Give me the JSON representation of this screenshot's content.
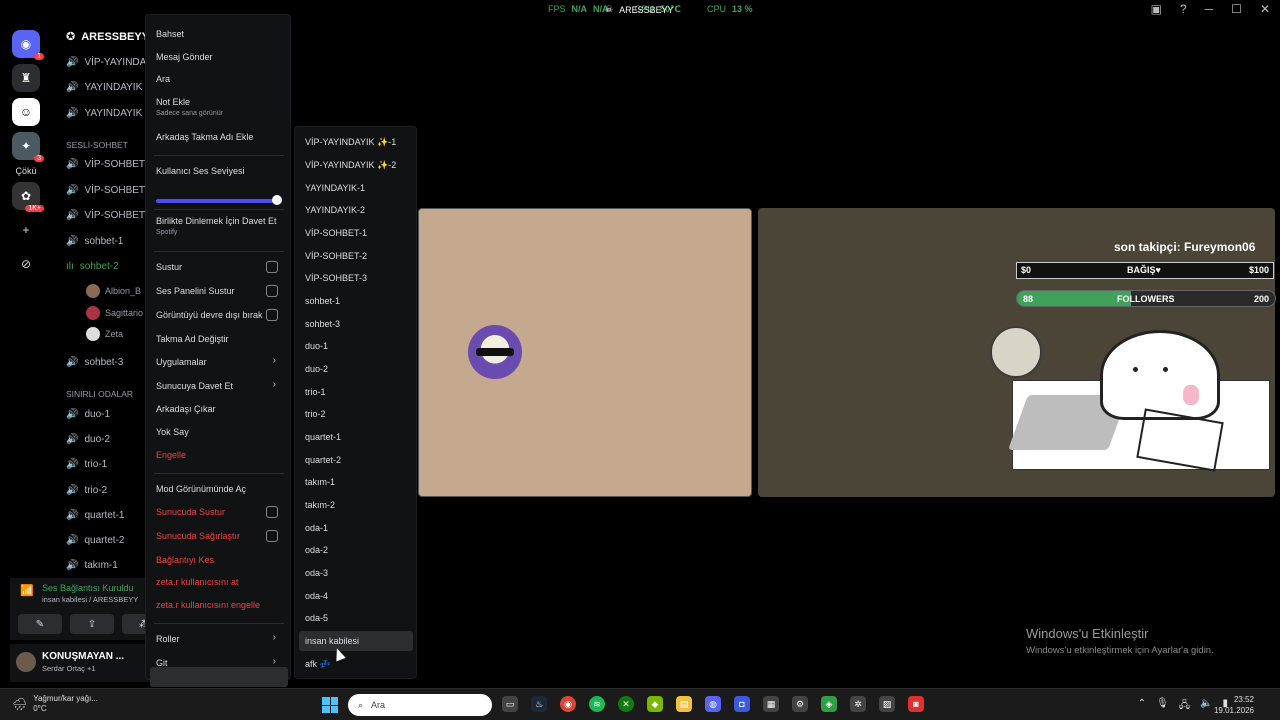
{
  "overlay": {
    "fps_label": "FPS",
    "fps_value": "N/A",
    "fps_value2": "N/A",
    "gpu_label": "GPU",
    "gpu_value": "50℃",
    "cpu_label": "CPU",
    "cpu_value": "13 %"
  },
  "server": {
    "name": "ARESSBEYY"
  },
  "rail": {
    "badge1": "1",
    "badge2": "3",
    "badge3": "1K+",
    "text_item": "Çökü"
  },
  "channels": {
    "header": "ARESSBEYY",
    "top": [
      "VİP-YAYINDA",
      "YAYINDAYIK",
      "YAYINDAYIK"
    ],
    "cat_sohbet": "SESLİ-SOHBET",
    "sohbet": [
      "VİP-SOHBET",
      "VİP-SOHBET",
      "VİP-SOHBET",
      "sohbet-1",
      "sohbet-2"
    ],
    "members": [
      "Albion_B",
      "Sagittario",
      "Zeta"
    ],
    "sohbet3": "sohbet-3",
    "cat_limited": "SINIRLI ODALAR",
    "limited": [
      "duo-1",
      "duo-2",
      "trio-1",
      "trio-2",
      "quartet-1",
      "quartet-2",
      "takım-1"
    ]
  },
  "voice": {
    "status": "Ses Bağlantısı Kuruldu",
    "location": "insan kabilesi / ARESSBEYY"
  },
  "user": {
    "name": "KONUŞMAYAN ...",
    "status": "Serdar Ortaç +1"
  },
  "context_menu": {
    "bahset": "Bahset",
    "mesaj": "Mesaj Gönder",
    "ara": "Ara",
    "not_ekle": "Not Ekle",
    "not_sub": "Sadece sana görünür",
    "takma_ekle": "Arkadaş Takma Adı Ekle",
    "ses_seviyesi": "Kullanıcı Ses Seviyesi",
    "dinleme": "Birlikte Dinlemek İçin Davet Et",
    "dinleme_sub": "Spotify",
    "sustur": "Sustur",
    "panel_sustur": "Ses Panelini Sustur",
    "goruntu": "Görüntüyü devre dışı bırak",
    "takma_degistir": "Takma Ad Değiştir",
    "uygulamalar": "Uygulamalar",
    "sunucuya_davet": "Sunucuya Davet Et",
    "arkadas_cikar": "Arkadaşı Çıkar",
    "yok_say": "Yok Say",
    "engelle": "Engelle",
    "mod_gorunum": "Mod Görünümünde Aç",
    "sunucuda_sustur": "Sunucuda Sustur",
    "sunucuda_sagir": "Sunucuda Sağırlaştır",
    "baglanti_kes": "Bağlantıyı Kes",
    "at": "zeta.r kullanıcısını at",
    "engelle_user": "zeta.r kullanıcısını engelle",
    "roller": "Roller",
    "git": "Git"
  },
  "submenu": [
    "VİP-YAYINDAYIK ✨-1",
    "VİP-YAYINDAYIK ✨-2",
    "YAYINDAYIK-1",
    "YAYINDAYIK-2",
    "VİP-SOHBET-1",
    "VİP-SOHBET-2",
    "VİP-SOHBET-3",
    "sohbet-1",
    "sohbet-3",
    "duo-1",
    "duo-2",
    "trio-1",
    "trio-2",
    "quartet-1",
    "quartet-2",
    "takım-1",
    "takım-2",
    "oda-1",
    "oda-2",
    "oda-3",
    "oda-4",
    "oda-5",
    "insan kabilesi",
    "afk 💤"
  ],
  "stream": {
    "follower": "son takipçi: Fureymon06",
    "donation_min": "$0",
    "donation_label": "BAĞIŞ♥",
    "donation_max": "$100",
    "follow_current": "88",
    "follow_label": "FOLLOWERS",
    "follow_goal": "200",
    "follow_progress": 0.44
  },
  "activation": {
    "title": "Windows'u Etkinleştir",
    "sub": "Windows'u etkinleştirmek için Ayarlar'a gidin."
  },
  "taskbar": {
    "weather": "Yağmur/kar yağı...",
    "temp": "0°C",
    "search": "Ara",
    "time": "23:52",
    "date": "19.01.2026"
  }
}
